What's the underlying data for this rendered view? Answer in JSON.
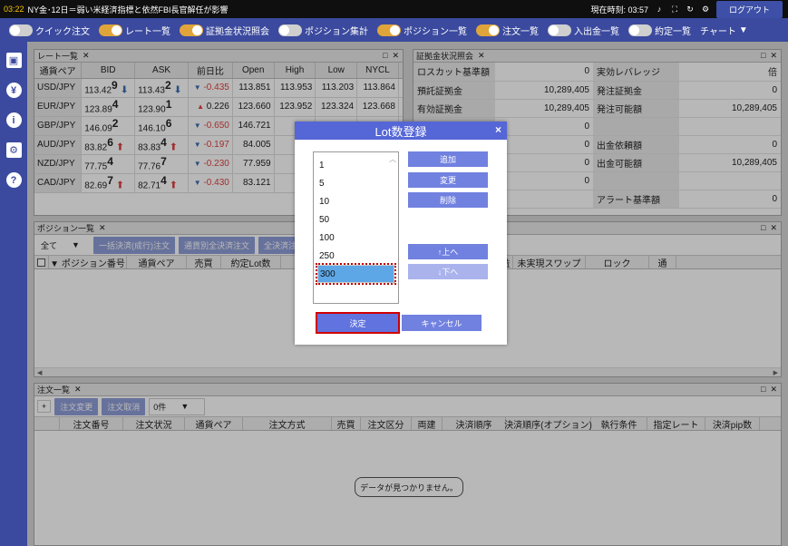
{
  "topbar": {
    "clock": "03:22",
    "news": "NY金･12日＝弱い米経済指標と依然FBI長官解任が影響",
    "current_time_label": "現在時刻: 03:57",
    "logout": "ログアウト"
  },
  "nav": {
    "items": [
      {
        "label": "クイック注文",
        "on": false
      },
      {
        "label": "レート一覧",
        "on": true
      },
      {
        "label": "証拠金状況照会",
        "on": true
      },
      {
        "label": "ポジション集計",
        "on": false
      },
      {
        "label": "ポジション一覧",
        "on": true
      },
      {
        "label": "注文一覧",
        "on": true
      },
      {
        "label": "入出金一覧",
        "on": false
      },
      {
        "label": "約定一覧",
        "on": false
      }
    ],
    "chart": "チャート"
  },
  "rate_panel": {
    "title": "レート一覧",
    "headers": [
      "通貨ペア",
      "BID",
      "ASK",
      "前日比",
      "Open",
      "High",
      "Low",
      "NYCL",
      "最"
    ],
    "rows": [
      {
        "pair": "USD/JPY",
        "bid_main": "113.42",
        "bid_pip": "9",
        "bid_dir": "down",
        "ask_main": "113.43",
        "ask_pip": "2",
        "ask_dir": "down",
        "chg_dir": "down",
        "chg": "-0.435",
        "open": "113.851",
        "high": "113.953",
        "low": "113.203",
        "nycl": "113.864"
      },
      {
        "pair": "EUR/JPY",
        "bid_main": "123.89",
        "bid_pip": "4",
        "bid_dir": "",
        "ask_main": "123.90",
        "ask_pip": "1",
        "ask_dir": "",
        "chg_dir": "up",
        "chg": "0.226",
        "open": "123.660",
        "high": "123.952",
        "low": "123.324",
        "nycl": "123.668"
      },
      {
        "pair": "GBP/JPY",
        "bid_main": "146.09",
        "bid_pip": "2",
        "bid_dir": "",
        "ask_main": "146.10",
        "ask_pip": "6",
        "ask_dir": "",
        "chg_dir": "down",
        "chg": "-0.650",
        "open": "146.721",
        "high": "146.",
        "low": "",
        "nycl": ""
      },
      {
        "pair": "AUD/JPY",
        "bid_main": "83.82",
        "bid_pip": "6",
        "bid_dir": "up",
        "ask_main": "83.83",
        "ask_pip": "4",
        "ask_dir": "up",
        "chg_dir": "down",
        "chg": "-0.197",
        "open": "84.005",
        "high": "84.",
        "low": "",
        "nycl": ""
      },
      {
        "pair": "NZD/JPY",
        "bid_main": "77.75",
        "bid_pip": "4",
        "bid_dir": "",
        "ask_main": "77.76",
        "ask_pip": "7",
        "ask_dir": "",
        "chg_dir": "down",
        "chg": "-0.230",
        "open": "77.959",
        "high": "77.",
        "low": "",
        "nycl": ""
      },
      {
        "pair": "CAD/JPY",
        "bid_main": "82.69",
        "bid_pip": "7",
        "bid_dir": "up",
        "ask_main": "82.71",
        "ask_pip": "4",
        "ask_dir": "up",
        "chg_dir": "down",
        "chg": "-0.430",
        "open": "83.121",
        "high": "83.",
        "low": "",
        "nycl": ""
      }
    ]
  },
  "margin_panel": {
    "title": "証拠金状況照会",
    "rows": [
      {
        "l1": "ロスカット基準額",
        "v1": "0",
        "l2": "実効レバレッジ",
        "v2": "倍"
      },
      {
        "l1": "預託証拠金",
        "v1": "10,289,405",
        "l2": "発注証拠金",
        "v2": "0"
      },
      {
        "l1": "有効証拠金",
        "v1": "10,289,405",
        "l2": "発注可能額",
        "v2": "10,289,405"
      },
      {
        "l1": "",
        "v1": "0",
        "l2": "",
        "v2": ""
      },
      {
        "l1": "",
        "v1": "0",
        "l2": "出金依頼額",
        "v2": "0"
      },
      {
        "l1": "",
        "v1": "0",
        "l2": "出金可能額",
        "v2": "10,289,405"
      },
      {
        "l1": "",
        "v1": "0",
        "l2": "",
        "v2": ""
      },
      {
        "l1": "",
        "v1": "",
        "l2": "アラート基準額",
        "v2": "0"
      }
    ]
  },
  "position_panel": {
    "title": "ポジション一覧",
    "filter": "全て",
    "btn_bulk": "一括決済(成行)注文",
    "btn_pair": "通貨別全決済注文",
    "btn_all": "全決済注",
    "headers": [
      "",
      "▼ ポジション番号",
      "通貨ペア",
      "売買",
      "約定Lot数",
      "",
      "",
      "pip損益",
      "ポジション損益",
      "未実現スワップ",
      "ロック",
      "通"
    ]
  },
  "order_panel": {
    "title": "注文一覧",
    "plus": "+",
    "btn_change": "注文変更",
    "btn_cancel": "注文取消",
    "count": "0件",
    "headers": [
      "",
      "注文番号",
      "注文状況",
      "通貨ペア",
      "注文方式",
      "売買",
      "注文区分",
      "両建",
      "決済順序",
      "決済順序(オプション)",
      "執行条件",
      "指定レート",
      "決済pip数"
    ],
    "empty_msg": "データが見つかりません。"
  },
  "dialog": {
    "title": "Lot数登録",
    "close": "×",
    "lots": [
      "1",
      "5",
      "10",
      "50",
      "100",
      "250",
      "300"
    ],
    "selected": "300",
    "add": "追加",
    "change": "変更",
    "delete": "削除",
    "up": "↑上へ",
    "down": "↓下へ",
    "ok": "決定",
    "cancel": "キャンセル"
  }
}
